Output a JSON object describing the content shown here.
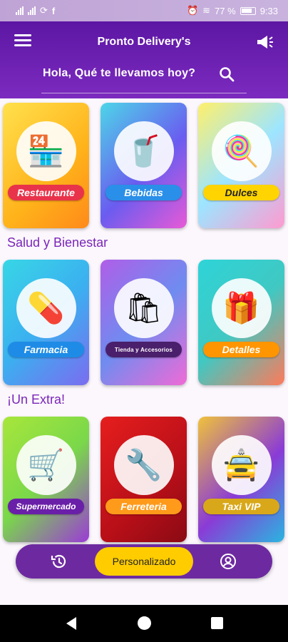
{
  "status_bar": {
    "left_icons": [
      "signal-icon",
      "signal-icon",
      "sync-icon",
      "facebook-icon"
    ],
    "battery": "77 %",
    "time": "9:33"
  },
  "header": {
    "title": "Pronto Delivery's",
    "greeting": "Hola, Qué te llevamos hoy?",
    "menu_icon": "menu-icon",
    "announce_icon": "megaphone-icon",
    "search_icon": "search-icon"
  },
  "sections": [
    {
      "title": "",
      "cards": [
        {
          "label": "Restaurante",
          "icon": "🏪",
          "pill": "#e8334a",
          "bg": "linear-gradient(135deg,#ffe14d,#ffb21a 60%,#ff8a1a)"
        },
        {
          "label": "Bebidas",
          "icon": "🥤",
          "pill": "#2a8fe8",
          "bg": "linear-gradient(135deg,#4dd6e8,#6a5cf0 55%,#e85ad6)"
        },
        {
          "label": "Dulces",
          "icon": "🍭",
          "pill": "#ffd400",
          "bg": "linear-gradient(135deg,#fff06b,#9de5ff 50%,#ff9ad0)"
        }
      ]
    },
    {
      "title": "Salud y Bienestar",
      "cards": [
        {
          "label": "Farmacia",
          "icon": "💊",
          "pill": "#1e8ce6",
          "bg": "linear-gradient(135deg,#38d6e6,#3bb0f0 50%,#7b6cf0)"
        },
        {
          "label": "Tienda y Accesorios",
          "icon": "🛍",
          "pill": "#4a1f6b",
          "bg": "linear-gradient(135deg,#b05ee8,#6f8cf0 50%,#f06ad6)"
        },
        {
          "label": "Detalles",
          "icon": "🎁",
          "pill": "#ff9500",
          "bg": "linear-gradient(135deg,#2ed4d8,#40c8c2 50%,#ff7a5a)"
        }
      ]
    },
    {
      "title": "¡Un Extra!",
      "cards": [
        {
          "label": "Supermercado",
          "icon": "🛒",
          "pill": "#6a1fa8",
          "bg": "linear-gradient(135deg,#a8e63b,#7ad84a 50%,#9b3bd6)"
        },
        {
          "label": "Ferreteria",
          "icon": "🔧",
          "pill": "#ff9a1a",
          "bg": "linear-gradient(135deg,#e61e1e,#b80f18 60%,#8a0a14)"
        },
        {
          "label": "Taxi VIP",
          "icon": "🚖",
          "pill": "#d9a81a",
          "bg": "linear-gradient(135deg,#f0c23a,#8a3bd6 55%,#2ab5e0)"
        }
      ]
    }
  ],
  "bottom_nav": {
    "history_icon": "history-icon",
    "center_label": "Personalizado",
    "profile_icon": "profile-icon"
  },
  "system_nav": [
    "back-icon",
    "home-icon",
    "recents-icon"
  ]
}
